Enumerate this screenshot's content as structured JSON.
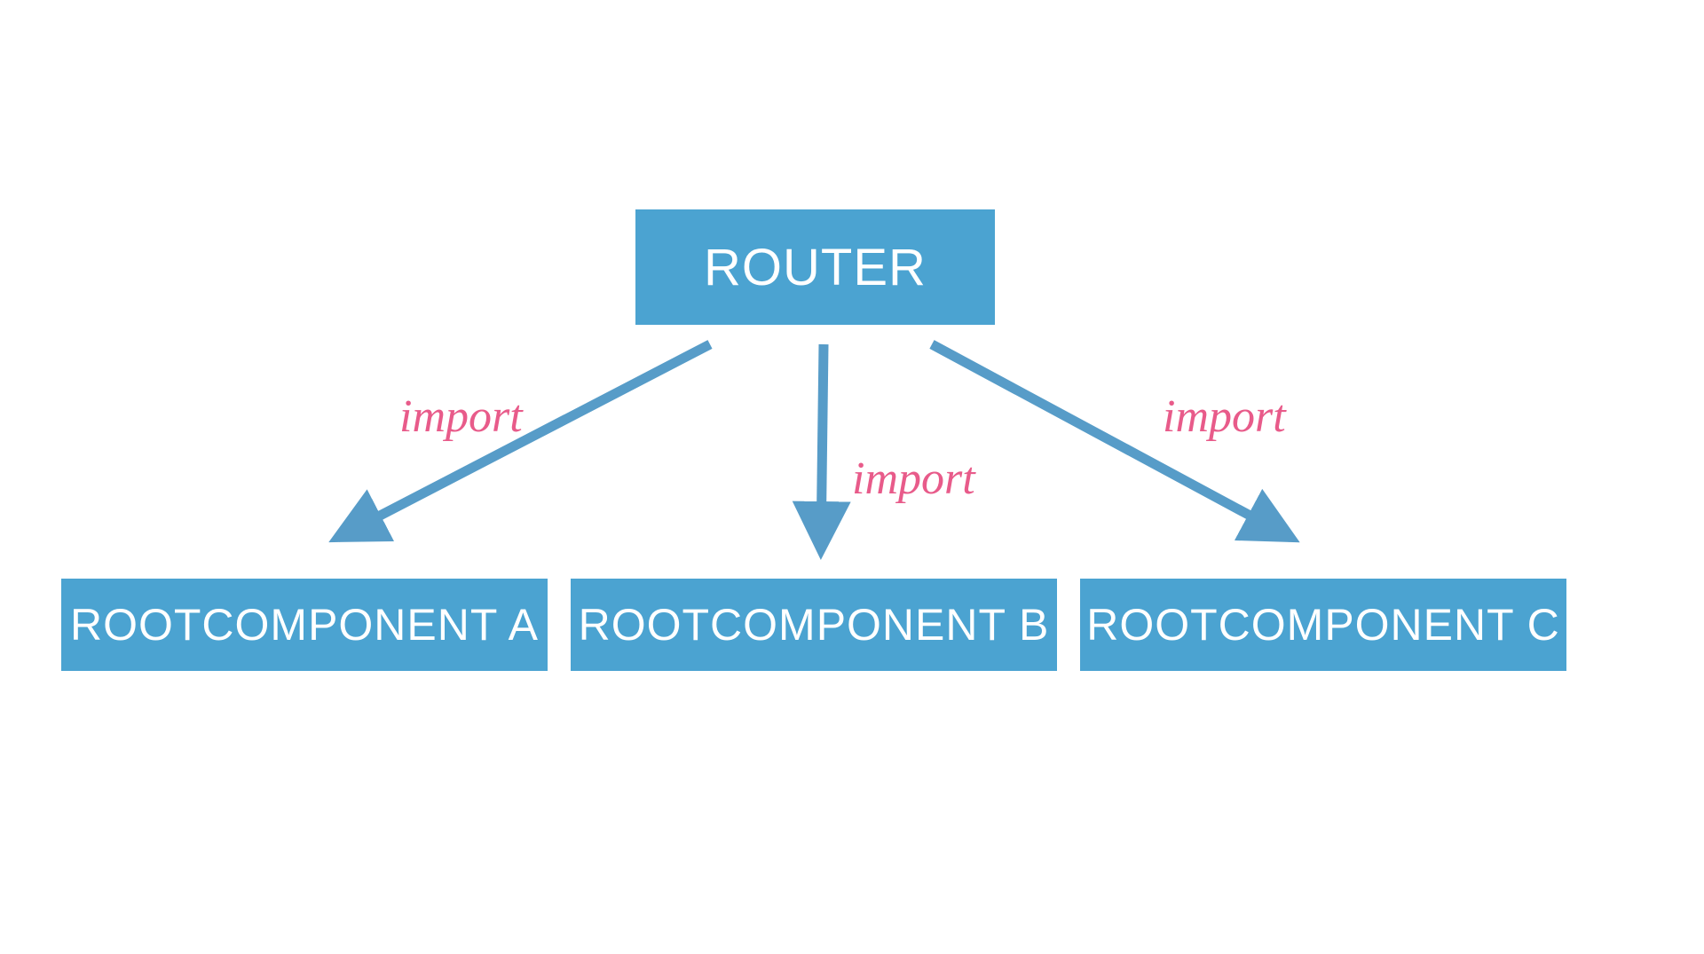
{
  "diagram": {
    "root": {
      "label": "ROUTER"
    },
    "children": [
      {
        "label": "ROOTCOMPONENT A",
        "edge_label": "import"
      },
      {
        "label": "ROOTCOMPONENT B",
        "edge_label": "import"
      },
      {
        "label": "ROOTCOMPONENT C",
        "edge_label": "import"
      }
    ]
  },
  "colors": {
    "box_fill": "#4ba3d1",
    "box_text": "#ffffff",
    "arrow": "#579cc8",
    "edge_label": "#e85b8a",
    "background": "#ffffff"
  }
}
